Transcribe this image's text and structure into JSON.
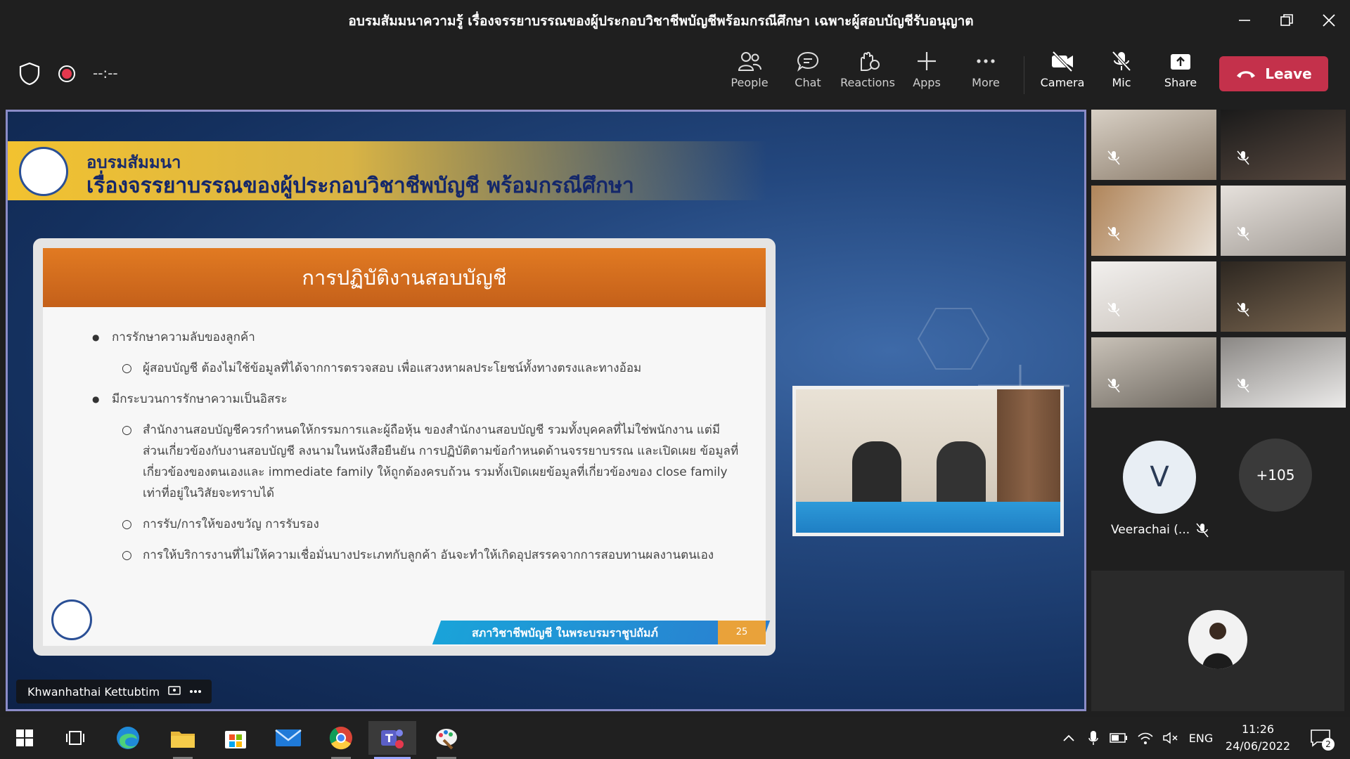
{
  "window": {
    "title": "อบรมสัมมนาความรู้ เรื่องจรรยาบรรณของผู้ประกอบวิชาชีพบัญชีพร้อมกรณีศึกษา เฉพาะผู้สอบบัญชีรับอนุญาต"
  },
  "meeting": {
    "timer": "--:--",
    "toolbar": {
      "people": "People",
      "chat": "Chat",
      "reactions": "Reactions",
      "apps": "Apps",
      "more": "More",
      "camera": "Camera",
      "mic": "Mic",
      "share": "Share",
      "leave": "Leave"
    },
    "presenter_name": "Khwanhathai Kettubtim"
  },
  "slide": {
    "header_line1": "อบรมสัมมนา",
    "header_line2": "เรื่องจรรยาบรรณของผู้ประกอบวิชาชีพบัญชี พร้อมกรณีศึกษา",
    "card_title": "การปฏิบัติงานสอบบัญชี",
    "bullets": [
      {
        "text": "การรักษาความลับของลูกค้า",
        "sub": [
          "ผู้สอบบัญชี ต้องไม่ใช้ข้อมูลที่ได้จากการตรวจสอบ เพื่อแสวงหาผลประโยชน์ทั้งทางตรงและทางอ้อม"
        ]
      },
      {
        "text": "มีกระบวนการรักษาความเป็นอิสระ",
        "sub": [
          "สำนักงานสอบบัญชีควรกำหนดให้กรรมการและผู้ถือหุ้น ของสำนักงานสอบบัญชี รวมทั้งบุคคลที่ไม่ใช่พนักงาน แต่มีส่วนเกี่ยวข้องกับงานสอบบัญชี ลงนามในหนังสือยืนยัน การปฏิบัติตามข้อกำหนดด้านจรรยาบรรณ และเปิดเผย ข้อมูลที่เกี่ยวข้องของตนเองและ immediate family ให้ถูกต้องครบถ้วน รวมทั้งเปิดเผยข้อมูลที่เกี่ยวข้องของ close family เท่าที่อยู่ในวิสัยจะทราบได้",
          "การรับ/การให้ของขวัญ การรับรอง",
          "การให้บริการงานที่ไม่ให้ความเชื่อมั่นบางประเภทกับลูกค้า อันจะทำให้เกิดอุปสรรคจากการสอบทานผลงานตนเอง"
        ]
      }
    ],
    "footer_text": "สภาวิชาชีพบัญชี ในพระบรมราชูปถัมภ์",
    "page_number": "25"
  },
  "participants": {
    "featured_name": "Veerachai (...",
    "featured_initial": "V",
    "overflow_count": "+105"
  },
  "taskbar": {
    "language": "ENG",
    "time": "11:26",
    "date": "24/06/2022",
    "notification_count": "2"
  }
}
